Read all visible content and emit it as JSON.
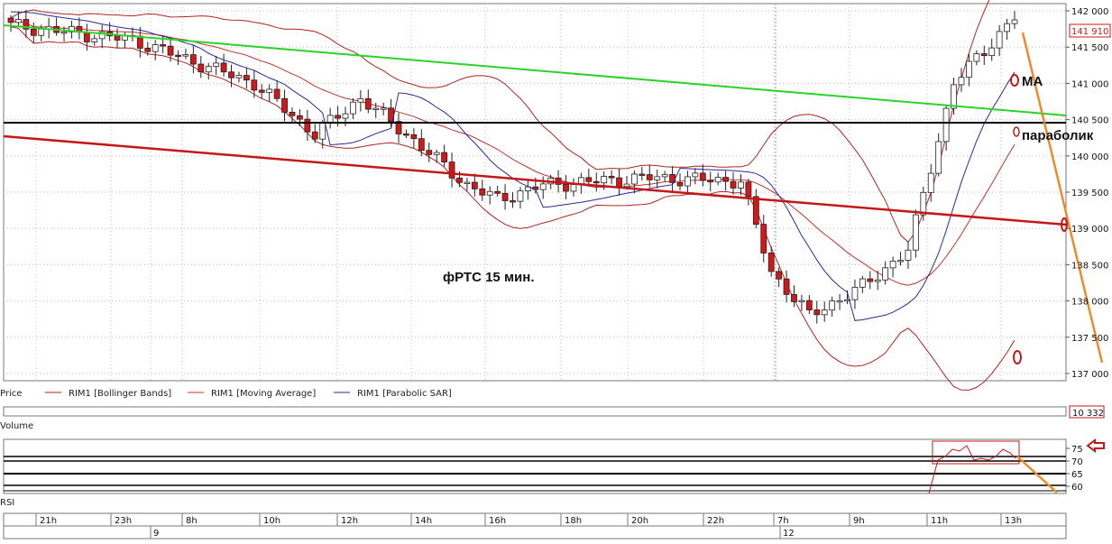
{
  "price_panel": {
    "y_ticks": [
      "142 000",
      "141 500",
      "141 000",
      "140 500",
      "140 000",
      "139 500",
      "139 000",
      "138 500",
      "138 000",
      "137 500",
      "137 000"
    ],
    "current_price": "141 910",
    "legend": {
      "price": "Price",
      "bollinger": "RIM1 [Bollinger Bands]",
      "ma": "RIM1 [Moving Average]",
      "sar": "RIM1 [Parabolic SAR]"
    },
    "annotations": {
      "chart_label": "фРТС   15 мин.",
      "ma_label": "МА",
      "sar_label": "параболик"
    }
  },
  "volume_panel": {
    "label": "Volume",
    "value": "10 332"
  },
  "rsi_panel": {
    "label": "RSI",
    "y_ticks": [
      "75",
      "70",
      "65",
      "60"
    ]
  },
  "time_axis": {
    "hours": [
      "21h",
      "23h",
      "8h",
      "10h",
      "12h",
      "14h",
      "16h",
      "18h",
      "20h",
      "22h",
      "7h",
      "9h",
      "11h",
      "13h"
    ],
    "days": [
      "9",
      "12"
    ]
  },
  "colors": {
    "candle_up": "#ffffff",
    "candle_down": "#d21818",
    "bollinger": "#b0241e",
    "moving_average": "#c0342a",
    "parabolic_sar": "#2a2a9a",
    "green_trend": "#28d428",
    "red_trend": "#c41818",
    "orange_projection": "#ef8a2a"
  },
  "chart_data": {
    "type": "candlestick",
    "ylim": [
      136900,
      142100
    ],
    "rsi_ylim": [
      58,
      78
    ],
    "bars_count": 133,
    "candles_key_points": [
      {
        "bar": 0,
        "close": 141800
      },
      {
        "bar": 16,
        "close": 141600
      },
      {
        "bar": 32,
        "close": 141000
      },
      {
        "bar": 40,
        "close": 140300
      },
      {
        "bar": 46,
        "close": 140800
      },
      {
        "bar": 52,
        "close": 140300
      },
      {
        "bar": 60,
        "close": 139600
      },
      {
        "bar": 64,
        "close": 139400
      },
      {
        "bar": 70,
        "close": 139600
      },
      {
        "bar": 84,
        "close": 139700
      },
      {
        "bar": 96,
        "close": 139650
      },
      {
        "bar": 100,
        "close": 138400
      },
      {
        "bar": 105,
        "close": 137800
      },
      {
        "bar": 112,
        "close": 138200
      },
      {
        "bar": 118,
        "close": 138700
      },
      {
        "bar": 124,
        "close": 141000
      },
      {
        "bar": 132,
        "close": 141910
      }
    ]
  }
}
